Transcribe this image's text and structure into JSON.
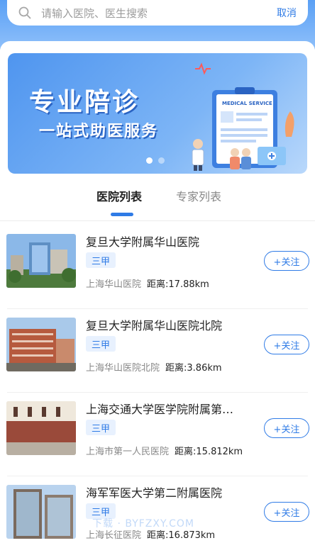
{
  "search": {
    "placeholder": "请输入医院、医生搜索",
    "cancel_label": "取消"
  },
  "banner": {
    "title": "专业陪诊",
    "subtitle": "一站式助医服务",
    "card_label": "MEDICAL SERVICE",
    "page_count": 2,
    "active_page": 1
  },
  "tabs": [
    {
      "label": "医院列表",
      "active": true
    },
    {
      "label": "专家列表",
      "active": false
    }
  ],
  "hospitals": [
    {
      "name": "复旦大学附属华山医院",
      "level": "三甲",
      "address": "上海华山医院",
      "distance": "距离:17.88km",
      "follow_label": "+关注"
    },
    {
      "name": "复旦大学附属华山医院北院",
      "level": "三甲",
      "address": "上海华山医院北院",
      "distance": "距离:3.86km",
      "follow_label": "+关注"
    },
    {
      "name": "上海交通大学医学院附属第…",
      "level": "三甲",
      "address": "上海市第一人民医院",
      "distance": "距离:15.812km",
      "follow_label": "+关注"
    },
    {
      "name": "海军军医大学第二附属医院",
      "level": "三甲",
      "address": "上海长征医院",
      "distance": "距离:16.873km",
      "follow_label": "+关注"
    }
  ],
  "watermark": "下载 · BYFZXY.COM",
  "colors": {
    "accent": "#2f7be6",
    "badge_bg": "#e8f1fe",
    "header_gradient_top": "#5aa0f5"
  }
}
